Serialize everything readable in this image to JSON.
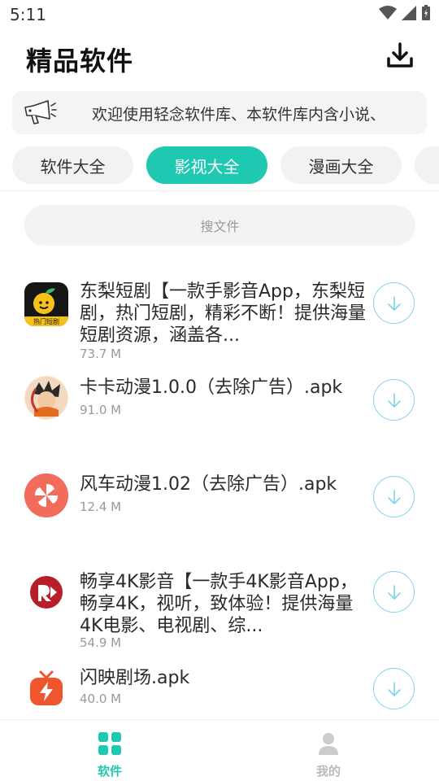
{
  "status_bar": {
    "time": "5:11"
  },
  "header": {
    "title": "精品软件",
    "download_icon": "download-icon"
  },
  "notice": {
    "text": "欢迎使用轻念软件库、本软件库内含小说、",
    "icon": "megaphone-icon"
  },
  "tabs": [
    {
      "label": "软件大全",
      "active": false
    },
    {
      "label": "影视大全",
      "active": true
    },
    {
      "label": "漫画大全",
      "active": false
    }
  ],
  "search": {
    "placeholder": "搜文件"
  },
  "items": [
    {
      "title": "东梨短剧【一款手影音App，东梨短剧，热门短剧，精彩不断！提供海量短剧资源，涵盖各...",
      "size": "73.7 M",
      "icon_label": "热门短剧"
    },
    {
      "title": "卡卡动漫1.0.0（去除广告）.apk",
      "size": "91.0 M"
    },
    {
      "title": "风车动漫1.02（去除广告）.apk",
      "size": "12.4 M"
    },
    {
      "title": "畅享4K影音【一款手4K影音App，畅享4K，视听，致体验！提供海量4K电影、电视剧、综...",
      "size": "54.9 M"
    },
    {
      "title": "闪映剧场.apk",
      "size": "40.0 M"
    }
  ],
  "bottom_nav": [
    {
      "label": "软件",
      "active": true,
      "icon": "grid-icon"
    },
    {
      "label": "我的",
      "active": false,
      "icon": "person-icon"
    }
  ],
  "colors": {
    "accent": "#1fc8b0",
    "download_ring": "#7fd3ec",
    "inactive": "#cccccc"
  }
}
